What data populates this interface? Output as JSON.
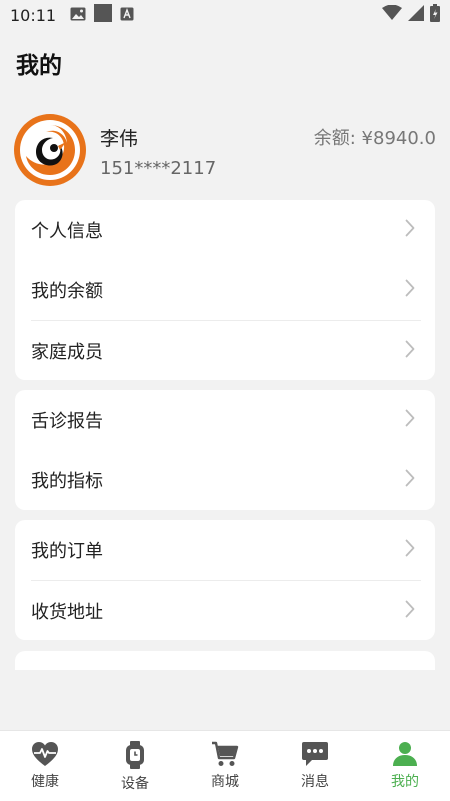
{
  "status_bar": {
    "time": "10:11"
  },
  "page": {
    "title": "我的"
  },
  "profile": {
    "name": "李伟",
    "phone": "151****2117",
    "balance": "余额: ¥8940.0"
  },
  "menu": {
    "group1": [
      "个人信息",
      "我的余额",
      "家庭成员"
    ],
    "group2": [
      "舌诊报告",
      "我的指标"
    ],
    "group3": [
      "我的订单",
      "收货地址"
    ]
  },
  "tabs": [
    {
      "label": "健康",
      "icon": "heart-pulse-icon"
    },
    {
      "label": "设备",
      "icon": "watch-icon"
    },
    {
      "label": "商城",
      "icon": "cart-icon"
    },
    {
      "label": "消息",
      "icon": "chat-icon"
    },
    {
      "label": "我的",
      "icon": "person-icon",
      "active": true
    }
  ],
  "colors": {
    "accent": "#4caf50",
    "background": "#f2f2f2",
    "avatar_orange": "#e8731a"
  }
}
